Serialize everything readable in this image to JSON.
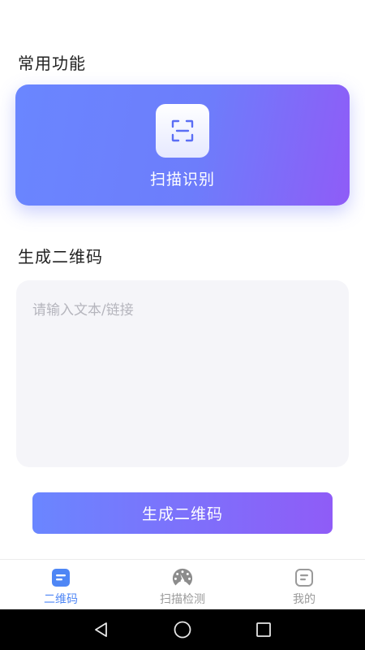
{
  "sections": {
    "common_title": "常用功能",
    "generate_title": "生成二维码"
  },
  "scan_card": {
    "label": "扫描识别",
    "icon": "scan-frame-icon",
    "gradient_start": "#6a86ff",
    "gradient_end": "#8f5cf7"
  },
  "generator": {
    "placeholder": "请输入文本/链接",
    "value": "",
    "button_label": "生成二维码"
  },
  "tab_bar": {
    "active_color": "#4e86f5",
    "inactive_color": "#9a9a9a",
    "tabs": [
      {
        "label": "二维码",
        "icon": "qrcode-doc-icon",
        "active": true
      },
      {
        "label": "扫描检测",
        "icon": "speedometer-icon",
        "active": false
      },
      {
        "label": "我的",
        "icon": "profile-doc-icon",
        "active": false
      }
    ]
  },
  "system_nav": {
    "buttons": [
      "back-icon",
      "home-icon",
      "recents-icon"
    ]
  }
}
